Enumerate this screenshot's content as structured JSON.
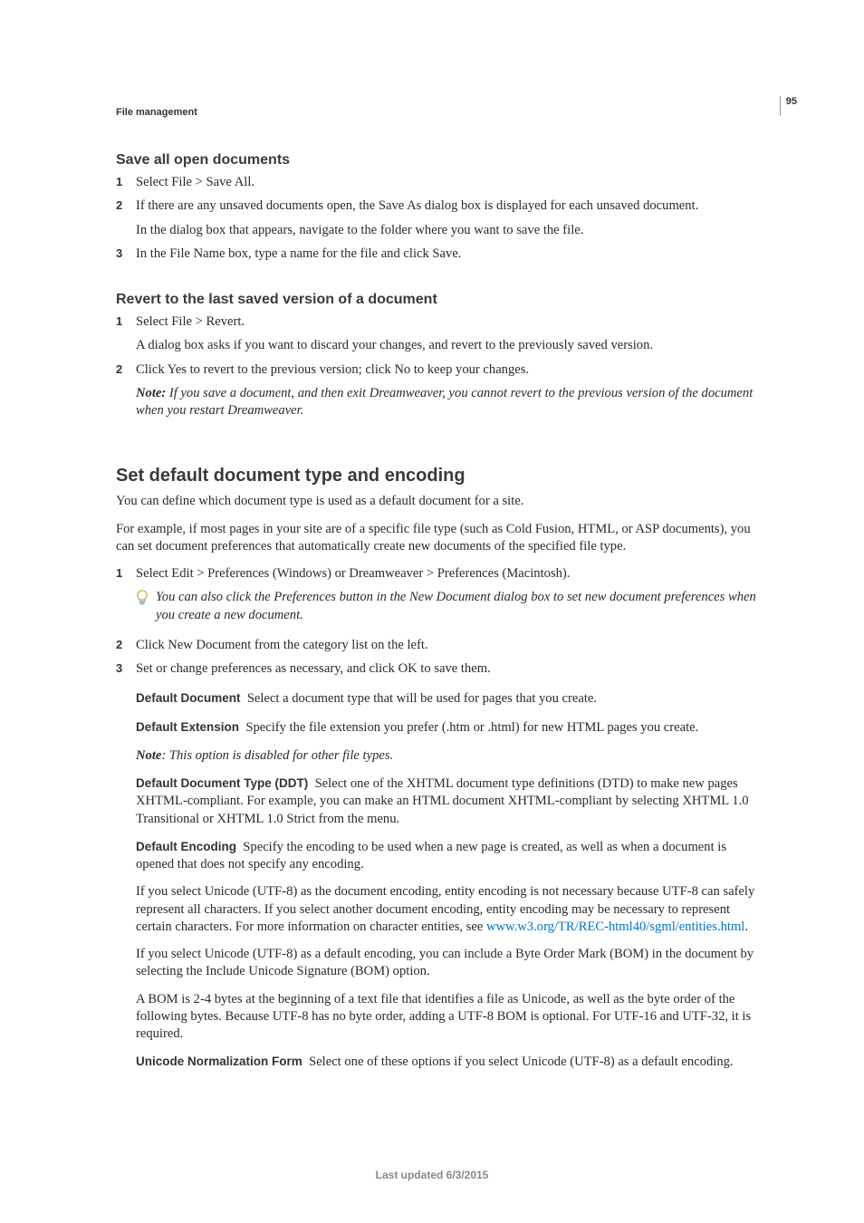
{
  "page_number": "95",
  "running_head": "File management",
  "section1": {
    "title": "Save all open documents",
    "steps": [
      {
        "n": "1",
        "paras": [
          "Select File > Save All."
        ]
      },
      {
        "n": "2",
        "paras": [
          "If there are any unsaved documents open, the Save As dialog box is displayed for each unsaved document.",
          "In the dialog box that appears, navigate to the folder where you want to save the file."
        ]
      },
      {
        "n": "3",
        "paras": [
          "In the File Name box, type a name for the file and click Save."
        ]
      }
    ]
  },
  "section2": {
    "title": "Revert to the last saved version of a document",
    "steps": [
      {
        "n": "1",
        "paras": [
          "Select File > Revert.",
          "A dialog box asks if you want to discard your changes, and revert to the previously saved version."
        ]
      },
      {
        "n": "2",
        "paras": [
          "Click Yes to revert to the previous version; click No to keep your changes."
        ],
        "note": {
          "label": "Note:",
          "text": " If you save a document, and then exit Dreamweaver, you cannot revert to the previous version of the document when you restart Dreamweaver."
        }
      }
    ]
  },
  "section3": {
    "title": "Set default document type and encoding",
    "intro": [
      "You can define which document type is used as a default document for a site.",
      "For example, if most pages in your site are of a specific file type (such as Cold Fusion, HTML, or ASP documents), you can set document preferences that automatically create new documents of the specified file type."
    ],
    "steps": [
      {
        "n": "1",
        "paras": [
          "Select Edit > Preferences (Windows) or Dreamweaver > Preferences (Macintosh)."
        ],
        "tip": "You can also click the Preferences button in the New Document dialog box to set new document preferences when you create a new document."
      },
      {
        "n": "2",
        "paras": [
          "Click New Document from the category list on the left."
        ]
      },
      {
        "n": "3",
        "paras": [
          "Set or change preferences as necessary, and click OK to save them."
        ]
      }
    ],
    "defs": {
      "d1_label": "Default Document",
      "d1_text": "Select a document type that will be used for pages that you create.",
      "d2_label": "Default Extension",
      "d2_text": "Specify the file extension you prefer (.htm or .html) for new HTML pages you create.",
      "note_label": "Note",
      "note_text": ": This option is disabled for other file types.",
      "d3_label": "Default Document Type (DDT)",
      "d3_text": "Select one of the XHTML document type definitions (DTD) to make new pages XHTML-compliant. For example, you can make an HTML document XHTML-compliant by selecting XHTML 1.0 Transitional or XHTML 1.0 Strict from the menu.",
      "d4_label": "Default Encoding",
      "d4_text": "Specify the encoding to be used when a new page is created, as well as when a document is opened that does not specify any encoding.",
      "d4_p2_a": "If you select Unicode (UTF-8) as the document encoding, entity encoding is not necessary because UTF-8 can safely represent all characters. If you select another document encoding, entity encoding may be necessary to represent certain characters. For more information on character entities, see ",
      "d4_link": "www.w3.org/TR/REC-html40/sgml/entities.html",
      "d4_p2_b": ".",
      "d4_p3": "If you select Unicode (UTF-8) as a default encoding, you can include a Byte Order Mark (BOM) in the document by selecting the Include Unicode Signature (BOM) option.",
      "d4_p4": "A BOM is 2-4 bytes at the beginning of a text file that identifies a file as Unicode, as well as the byte order of the following bytes. Because UTF-8 has no byte order, adding a UTF-8 BOM is optional. For UTF-16 and UTF-32, it is required.",
      "d5_label": "Unicode Normalization Form",
      "d5_text": "Select one of these options if you select Unicode (UTF-8) as a default encoding."
    }
  },
  "footer": "Last updated 6/3/2015"
}
